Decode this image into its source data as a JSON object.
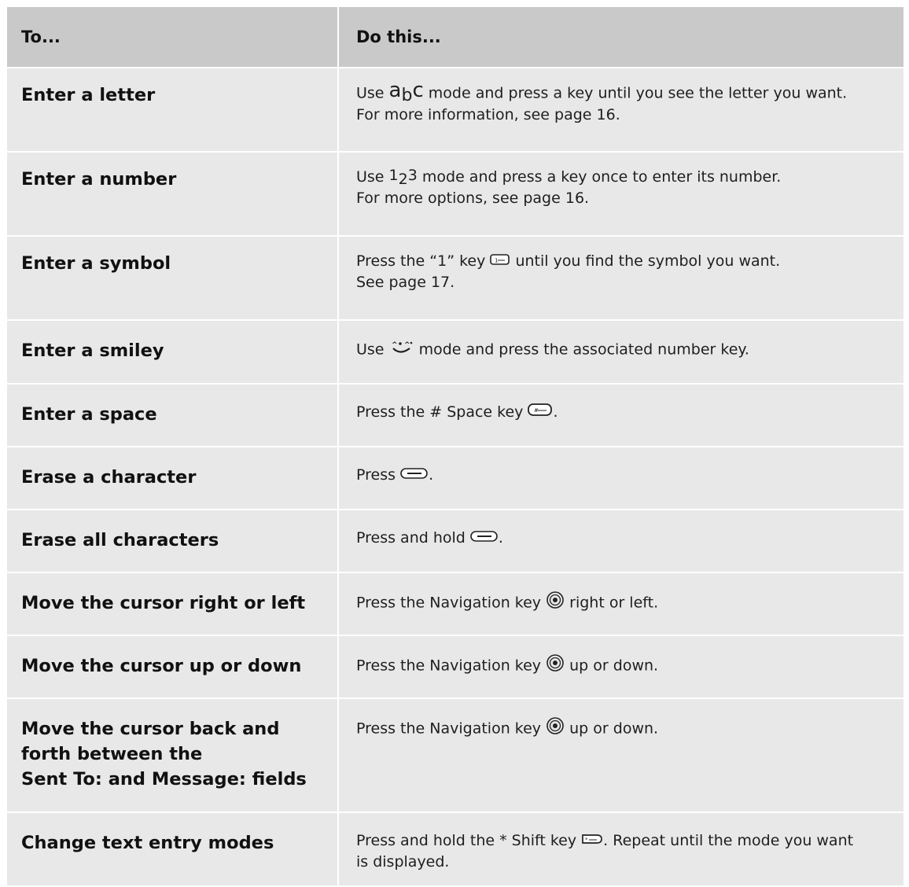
{
  "header": {
    "col1": "To...",
    "col2": "Do this..."
  },
  "rows": [
    {
      "action": "Enter a letter",
      "pre": "Use",
      "icon": "abc-mode-icon",
      "post": "mode and press a key until you see the letter you want.",
      "line2": "For more information, see page 16."
    },
    {
      "action": "Enter a number",
      "pre": "Use",
      "icon": "123-mode-icon",
      "post": "mode and press a key once to enter its number.",
      "line2": "For more options, see page 16."
    },
    {
      "action": "Enter a symbol",
      "pre": "Press the “1” key",
      "icon": "1-key-icon",
      "post": "until you find the symbol you want.",
      "line2": "See page 17."
    },
    {
      "action": "Enter a smiley",
      "pre": "Use",
      "icon": "smiley-mode-icon",
      "post": "mode and press the associated number key."
    },
    {
      "action": "Enter a space",
      "pre": "Press the # Space key",
      "icon": "space-key-icon",
      "post": "."
    },
    {
      "action": "Erase a character",
      "pre": "Press",
      "icon": "back-key-icon",
      "post": "."
    },
    {
      "action": "Erase all characters",
      "pre": "Press and hold",
      "icon": "back-key-icon",
      "post": "."
    },
    {
      "action": "Move the cursor right or left",
      "pre": "Press the Navigation key",
      "icon": "navigation-key-icon",
      "post": "right or left."
    },
    {
      "action": "Move the cursor up or down",
      "pre": "Press the Navigation key",
      "icon": "navigation-key-icon",
      "post": "up or down."
    },
    {
      "action_lines": [
        "Move the cursor back and",
        "forth between the",
        "Sent To: and Message: fields"
      ],
      "pre": "Press the Navigation key",
      "icon": "navigation-key-icon",
      "post": "up or down."
    },
    {
      "action": "Change text entry modes",
      "pre": "Press and hold the * Shift key",
      "icon": "shift-key-icon",
      "post": ". Repeat until the mode you want",
      "line2": "is displayed."
    }
  ],
  "icon_labels": {
    "abc": {
      "a": "a",
      "b": "b",
      "c": "c"
    },
    "num": {
      "one": "1",
      "two": "2",
      "three": "3"
    }
  }
}
